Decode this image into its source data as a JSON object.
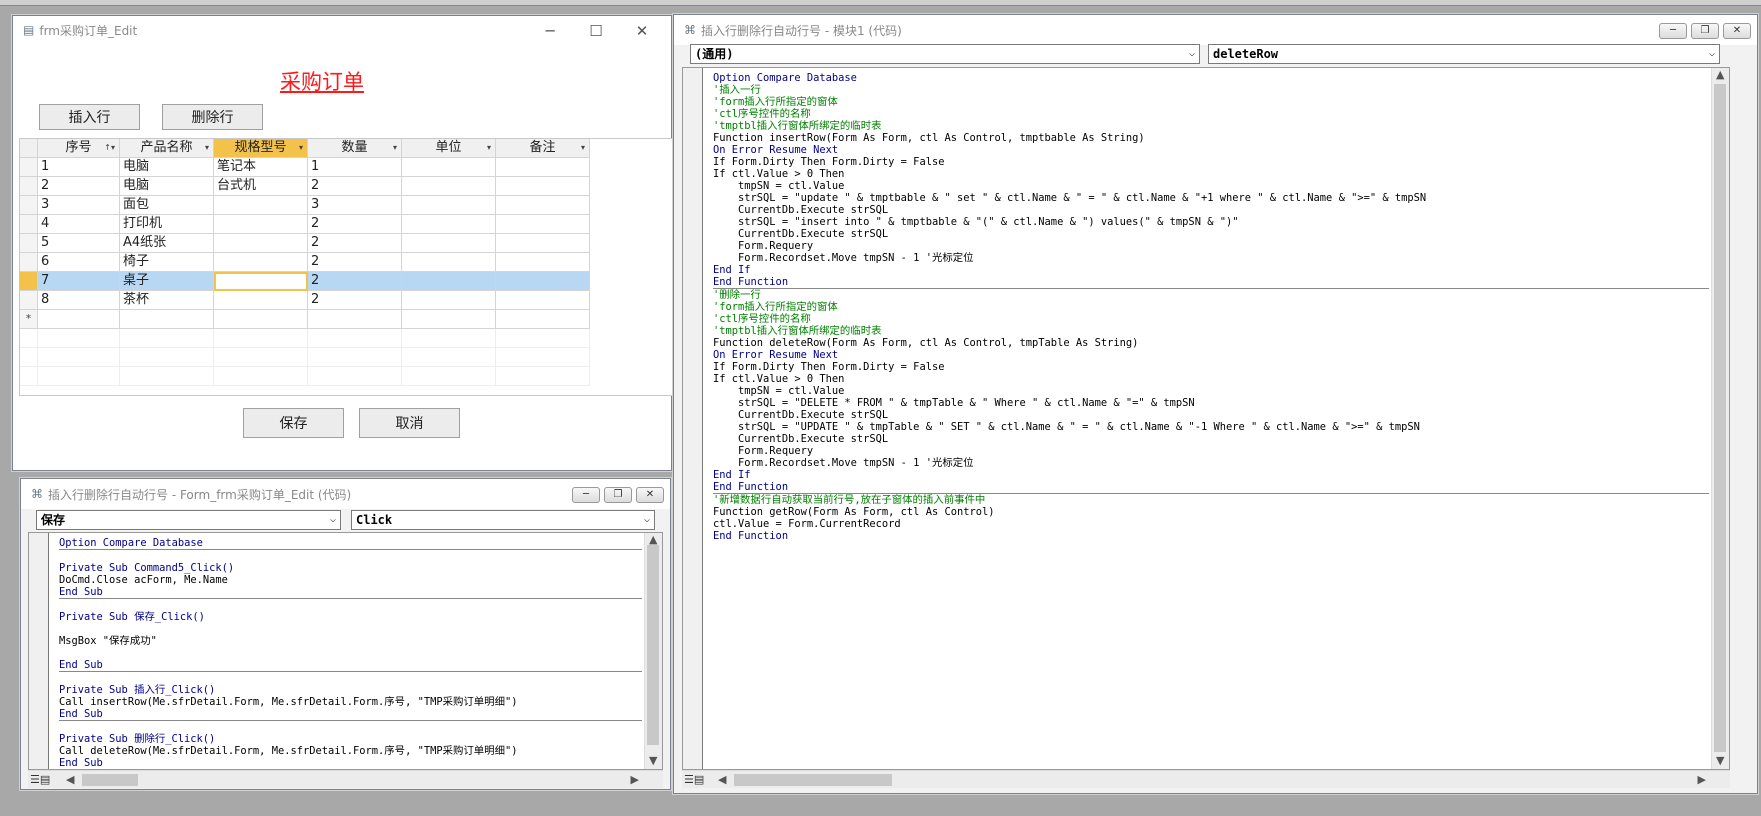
{
  "form_window": {
    "title": "frm采购订单_Edit",
    "heading": "采购订单",
    "insert_button": "插入行",
    "delete_button": "删除行",
    "save_button": "保存",
    "cancel_button": "取消",
    "columns": [
      "序号",
      "产品名称",
      "规格型号",
      "数量",
      "单位",
      "备注"
    ],
    "rows": [
      {
        "seq": "1",
        "name": "电脑",
        "spec": "笔记本",
        "qty": "1",
        "unit": "",
        "note": ""
      },
      {
        "seq": "2",
        "name": "电脑",
        "spec": "台式机",
        "qty": "2",
        "unit": "",
        "note": ""
      },
      {
        "seq": "3",
        "name": "面包",
        "spec": "",
        "qty": "3",
        "unit": "",
        "note": ""
      },
      {
        "seq": "4",
        "name": "打印机",
        "spec": "",
        "qty": "2",
        "unit": "",
        "note": ""
      },
      {
        "seq": "5",
        "name": "A4纸张",
        "spec": "",
        "qty": "2",
        "unit": "",
        "note": ""
      },
      {
        "seq": "6",
        "name": "椅子",
        "spec": "",
        "qty": "2",
        "unit": "",
        "note": ""
      },
      {
        "seq": "7",
        "name": "桌子",
        "spec": "",
        "qty": "2",
        "unit": "",
        "note": ""
      },
      {
        "seq": "8",
        "name": "茶杯",
        "spec": "",
        "qty": "2",
        "unit": "",
        "note": ""
      }
    ],
    "new_row_marker": "*",
    "current_row_index": 6
  },
  "code_window_small": {
    "title": "插入行删除行自动行号 - Form_frm采购订单_Edit (代码)",
    "object_combo": "保存",
    "proc_combo": "Click",
    "lines": [
      {
        "t": "Option Compare Database",
        "k": "kw"
      },
      {
        "sep": true
      },
      {
        "t": ""
      },
      {
        "t": "Private Sub Command5_Click()",
        "k": "kw"
      },
      {
        "t": "DoCmd.Close acForm, Me.Name"
      },
      {
        "t": "End Sub",
        "k": "kw"
      },
      {
        "sep": true
      },
      {
        "t": ""
      },
      {
        "t": "Private Sub 保存_Click()",
        "k": "kw"
      },
      {
        "t": ""
      },
      {
        "t": "MsgBox \"保存成功\""
      },
      {
        "t": ""
      },
      {
        "t": "End Sub",
        "k": "kw"
      },
      {
        "sep": true
      },
      {
        "t": ""
      },
      {
        "t": "Private Sub 插入行_Click()",
        "k": "kw"
      },
      {
        "t": "Call insertRow(Me.sfrDetail.Form, Me.sfrDetail.Form.序号, \"TMP采购订单明细\")"
      },
      {
        "t": "End Sub",
        "k": "kw"
      },
      {
        "sep": true
      },
      {
        "t": ""
      },
      {
        "t": "Private Sub 删除行_Click()",
        "k": "kw"
      },
      {
        "t": "Call deleteRow(Me.sfrDetail.Form, Me.sfrDetail.Form.序号, \"TMP采购订单明细\")"
      },
      {
        "t": "End Sub",
        "k": "kw"
      }
    ]
  },
  "code_window_main": {
    "title": "插入行删除行自动行号 - 模块1 (代码)",
    "object_combo": "(通用)",
    "proc_combo": "deleteRow",
    "lines": [
      {
        "t": "Option Compare Database",
        "k": "kw"
      },
      {
        "t": "'插入一行",
        "k": "cm"
      },
      {
        "t": "'form插入行所指定的窗体",
        "k": "cm"
      },
      {
        "t": "'ctl序号控件的名称",
        "k": "cm"
      },
      {
        "t": "'tmptbl插入行窗体所绑定的临时表",
        "k": "cm"
      },
      {
        "t": "Function insertRow(Form As Form, ctl As Control, tmptbable As String)"
      },
      {
        "t": "On Error Resume Next",
        "k": "kw"
      },
      {
        "t": "If Form.Dirty Then Form.Dirty = False"
      },
      {
        "t": "If ctl.Value > 0 Then"
      },
      {
        "t": "    tmpSN = ctl.Value"
      },
      {
        "t": "    strSQL = \"update \" & tmptbable & \" set \" & ctl.Name & \" = \" & ctl.Name & \"+1 where \" & ctl.Name & \">=\" & tmpSN"
      },
      {
        "t": "    CurrentDb.Execute strSQL"
      },
      {
        "t": "    strSQL = \"insert into \" & tmptbable & \"(\" & ctl.Name & \") values(\" & tmpSN & \")\""
      },
      {
        "t": "    CurrentDb.Execute strSQL"
      },
      {
        "t": "    Form.Requery"
      },
      {
        "t": "    Form.Recordset.Move tmpSN - 1 '光标定位"
      },
      {
        "t": "End If",
        "k": "kw"
      },
      {
        "t": "End Function",
        "k": "kw"
      },
      {
        "sep": true
      },
      {
        "t": "'删除一行",
        "k": "cm"
      },
      {
        "t": "'form插入行所指定的窗体",
        "k": "cm"
      },
      {
        "t": "'ctl序号控件的名称",
        "k": "cm"
      },
      {
        "t": "'tmptbl插入行窗体所绑定的临时表",
        "k": "cm"
      },
      {
        "t": "Function deleteRow(Form As Form, ctl As Control, tmpTable As String)"
      },
      {
        "t": "On Error Resume Next",
        "k": "kw"
      },
      {
        "t": "If Form.Dirty Then Form.Dirty = False"
      },
      {
        "t": "If ctl.Value > 0 Then"
      },
      {
        "t": "    tmpSN = ctl.Value"
      },
      {
        "t": "    strSQL = \"DELETE * FROM \" & tmpTable & \" Where \" & ctl.Name & \"=\" & tmpSN"
      },
      {
        "t": "    CurrentDb.Execute strSQL"
      },
      {
        "t": "    strSQL = \"UPDATE \" & tmpTable & \" SET \" & ctl.Name & \" = \" & ctl.Name & \"-1 Where \" & ctl.Name & \">=\" & tmpSN"
      },
      {
        "t": "    CurrentDb.Execute strSQL"
      },
      {
        "t": "    Form.Requery"
      },
      {
        "t": "    Form.Recordset.Move tmpSN - 1 '光标定位"
      },
      {
        "t": "End If",
        "k": "kw"
      },
      {
        "t": "End Function",
        "k": "kw"
      },
      {
        "sep": true
      },
      {
        "t": "'新增数据行自动获取当前行号,放在子窗体的插入前事件中",
        "k": "cm"
      },
      {
        "t": "Function getRow(Form As Form, ctl As Control)"
      },
      {
        "t": "ctl.Value = Form.CurrentRecord"
      },
      {
        "t": "End Function",
        "k": "kw"
      }
    ]
  },
  "icons": {
    "minimize": "─",
    "maximize": "☐",
    "close": "✕",
    "restore": "❐"
  }
}
